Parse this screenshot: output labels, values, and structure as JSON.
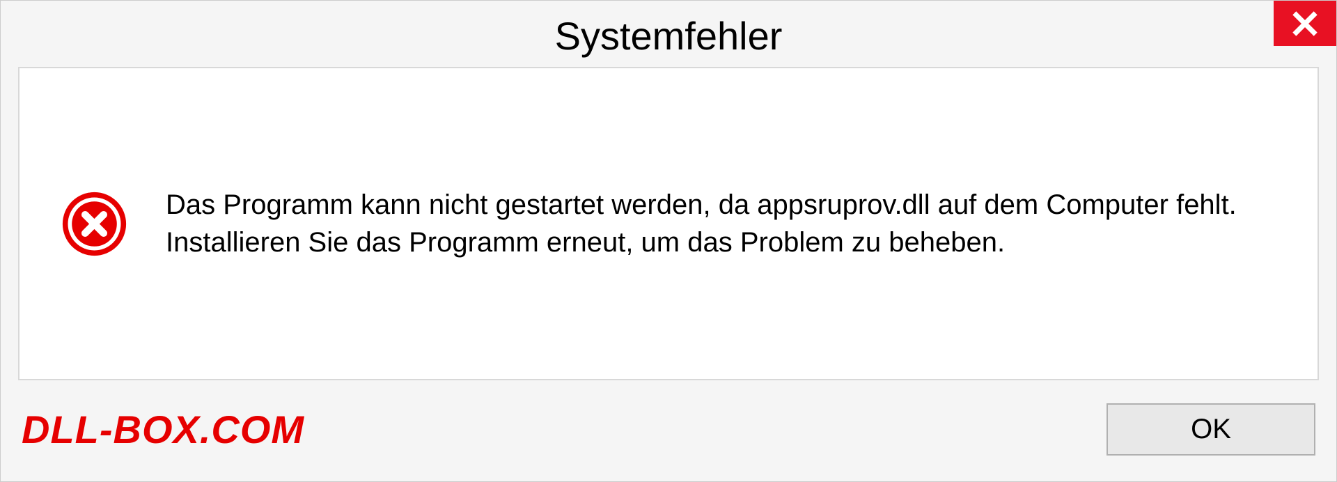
{
  "dialog": {
    "title": "Systemfehler",
    "message": "Das Programm kann nicht gestartet werden, da appsruprov.dll auf dem Computer fehlt. Installieren Sie das Programm erneut, um das Problem zu beheben.",
    "ok_label": "OK"
  },
  "watermark": "DLL-BOX.COM"
}
